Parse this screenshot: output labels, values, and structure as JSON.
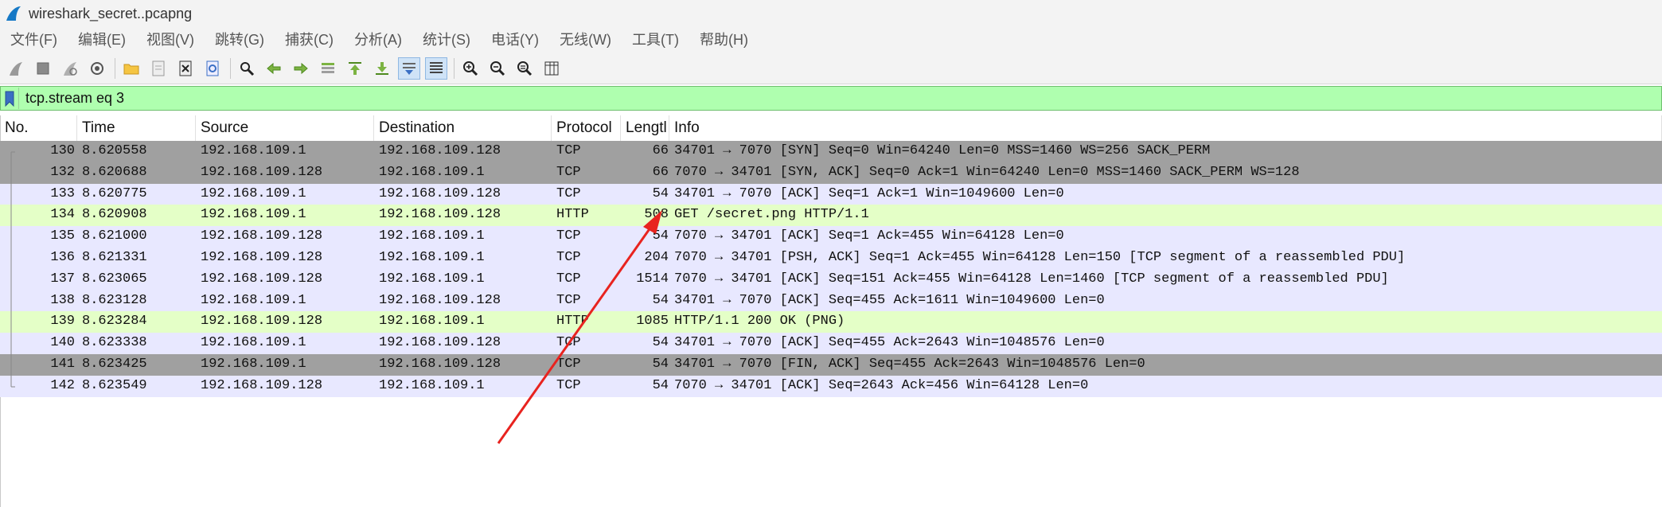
{
  "window": {
    "title": "wireshark_secret..pcapng"
  },
  "menu": [
    "文件(F)",
    "编辑(E)",
    "视图(V)",
    "跳转(G)",
    "捕获(C)",
    "分析(A)",
    "统计(S)",
    "电话(Y)",
    "无线(W)",
    "工具(T)",
    "帮助(H)"
  ],
  "toolbar": {
    "buttons": [
      {
        "icon": "shark-fin-start-icon"
      },
      {
        "icon": "stop-square-icon"
      },
      {
        "icon": "restart-fin-icon"
      },
      {
        "icon": "capture-options-gear-icon"
      },
      {
        "sep": true
      },
      {
        "icon": "open-folder-icon"
      },
      {
        "icon": "save-file-icon"
      },
      {
        "icon": "close-file-icon"
      },
      {
        "icon": "reload-icon"
      },
      {
        "sep": true
      },
      {
        "icon": "find-magnifier-icon"
      },
      {
        "icon": "go-back-arrow-icon"
      },
      {
        "icon": "go-forward-arrow-icon"
      },
      {
        "icon": "go-to-packet-icon"
      },
      {
        "icon": "first-packet-icon"
      },
      {
        "icon": "last-packet-icon"
      },
      {
        "icon": "auto-scroll-icon",
        "active": true
      },
      {
        "icon": "colorize-icon",
        "active": true
      },
      {
        "sep": true
      },
      {
        "icon": "zoom-in-icon"
      },
      {
        "icon": "zoom-out-icon"
      },
      {
        "icon": "zoom-normal-icon"
      },
      {
        "icon": "resize-columns-icon"
      }
    ]
  },
  "filter": {
    "text": "tcp.stream eq 3"
  },
  "columns": [
    "No.",
    "Time",
    "Source",
    "Destination",
    "Protocol",
    "Lengtl",
    "Info"
  ],
  "packets": [
    {
      "no": "130",
      "time": "8.620558",
      "src": "192.168.109.1",
      "dst": "192.168.109.128",
      "proto": "TCP",
      "len": "66",
      "info": "34701 → 7070 [SYN] Seq=0 Win=64240 Len=0 MSS=1460 WS=256 SACK_PERM",
      "kind": "syn"
    },
    {
      "no": "132",
      "time": "8.620688",
      "src": "192.168.109.128",
      "dst": "192.168.109.1",
      "proto": "TCP",
      "len": "66",
      "info": "7070 → 34701 [SYN, ACK] Seq=0 Ack=1 Win=64240 Len=0 MSS=1460 SACK_PERM WS=128",
      "kind": "syn"
    },
    {
      "no": "133",
      "time": "8.620775",
      "src": "192.168.109.1",
      "dst": "192.168.109.128",
      "proto": "TCP",
      "len": "54",
      "info": "34701 → 7070 [ACK] Seq=1 Ack=1 Win=1049600 Len=0",
      "kind": "tcp"
    },
    {
      "no": "134",
      "time": "8.620908",
      "src": "192.168.109.1",
      "dst": "192.168.109.128",
      "proto": "HTTP",
      "len": "508",
      "info": "GET /secret.png HTTP/1.1",
      "kind": "http"
    },
    {
      "no": "135",
      "time": "8.621000",
      "src": "192.168.109.128",
      "dst": "192.168.109.1",
      "proto": "TCP",
      "len": "54",
      "info": "7070 → 34701 [ACK] Seq=1 Ack=455 Win=64128 Len=0",
      "kind": "tcp"
    },
    {
      "no": "136",
      "time": "8.621331",
      "src": "192.168.109.128",
      "dst": "192.168.109.1",
      "proto": "TCP",
      "len": "204",
      "info": "7070 → 34701 [PSH, ACK] Seq=1 Ack=455 Win=64128 Len=150 [TCP segment of a reassembled PDU]",
      "kind": "tcp"
    },
    {
      "no": "137",
      "time": "8.623065",
      "src": "192.168.109.128",
      "dst": "192.168.109.1",
      "proto": "TCP",
      "len": "1514",
      "info": "7070 → 34701 [ACK] Seq=151 Ack=455 Win=64128 Len=1460 [TCP segment of a reassembled PDU]",
      "kind": "tcp"
    },
    {
      "no": "138",
      "time": "8.623128",
      "src": "192.168.109.1",
      "dst": "192.168.109.128",
      "proto": "TCP",
      "len": "54",
      "info": "34701 → 7070 [ACK] Seq=455 Ack=1611 Win=1049600 Len=0",
      "kind": "tcp"
    },
    {
      "no": "139",
      "time": "8.623284",
      "src": "192.168.109.128",
      "dst": "192.168.109.1",
      "proto": "HTTP",
      "len": "1085",
      "info": "HTTP/1.1 200 OK  (PNG)",
      "kind": "http"
    },
    {
      "no": "140",
      "time": "8.623338",
      "src": "192.168.109.1",
      "dst": "192.168.109.128",
      "proto": "TCP",
      "len": "54",
      "info": "34701 → 7070 [ACK] Seq=455 Ack=2643 Win=1048576 Len=0",
      "kind": "tcp"
    },
    {
      "no": "141",
      "time": "8.623425",
      "src": "192.168.109.1",
      "dst": "192.168.109.128",
      "proto": "TCP",
      "len": "54",
      "info": "34701 → 7070 [FIN, ACK] Seq=455 Ack=2643 Win=1048576 Len=0",
      "kind": "fin"
    },
    {
      "no": "142",
      "time": "8.623549",
      "src": "192.168.109.128",
      "dst": "192.168.109.1",
      "proto": "TCP",
      "len": "54",
      "info": "7070 → 34701 [ACK] Seq=2643 Ack=456 Win=64128 Len=0",
      "kind": "tcp"
    }
  ],
  "colors": {
    "tcp": "#e8e8ff",
    "http": "#e4ffc7",
    "syn": "#a0a0a0",
    "fin": "#a0a0a0",
    "filter_bg": "#afffaf",
    "annotation_arrow": "#e8231f"
  },
  "annotation": {
    "type": "red-arrow",
    "points_to": "GET /secret.png HTTP/1.1"
  }
}
